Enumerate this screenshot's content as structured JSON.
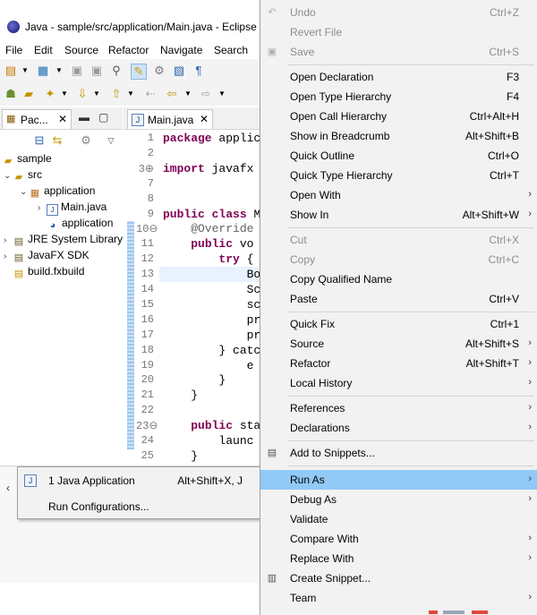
{
  "window": {
    "title": "Java - sample/src/application/Main.java - Eclipse"
  },
  "menubar": [
    "File",
    "Edit",
    "Source",
    "Refactor",
    "Navigate",
    "Search"
  ],
  "package_explorer": {
    "tab_label": "Pac...",
    "tree": [
      {
        "label": "sample",
        "icon": "project-icon"
      },
      {
        "label": "src",
        "icon": "source-folder-icon"
      },
      {
        "label": "application",
        "icon": "package-icon"
      },
      {
        "label": "Main.java",
        "icon": "java-file-icon"
      },
      {
        "label": "application",
        "icon": "css-file-icon"
      },
      {
        "label": "JRE System Library",
        "icon": "library-icon"
      },
      {
        "label": "JavaFX SDK",
        "icon": "library-icon"
      },
      {
        "label": "build.fxbuild",
        "icon": "file-icon"
      }
    ]
  },
  "editor": {
    "tab_label": "Main.java",
    "lines": [
      {
        "n": "1",
        "code": "package applic"
      },
      {
        "n": "2",
        "code": ""
      },
      {
        "n": "3⊕",
        "code": "import javafx"
      },
      {
        "n": "7",
        "code": ""
      },
      {
        "n": "8",
        "code": ""
      },
      {
        "n": "9",
        "code": "public class M"
      },
      {
        "n": "10⊖",
        "code": "    @Override"
      },
      {
        "n": "11",
        "code": "    public vo"
      },
      {
        "n": "12",
        "code": "        try {"
      },
      {
        "n": "13",
        "code": "            Bo"
      },
      {
        "n": "14",
        "code": "            Sc"
      },
      {
        "n": "15",
        "code": "            sc"
      },
      {
        "n": "16",
        "code": "            pr"
      },
      {
        "n": "17",
        "code": "            pr"
      },
      {
        "n": "18",
        "code": "        } catc"
      },
      {
        "n": "19",
        "code": "            e"
      },
      {
        "n": "20",
        "code": "        }"
      },
      {
        "n": "21",
        "code": "    }"
      },
      {
        "n": "22",
        "code": ""
      },
      {
        "n": "23⊖",
        "code": "    public sta"
      },
      {
        "n": "24",
        "code": "        launc"
      },
      {
        "n": "25",
        "code": "    }"
      }
    ]
  },
  "submenu": {
    "items": [
      {
        "label": "1 Java Application",
        "accel": "Alt+Shift+X, J",
        "icon": "java-app-icon"
      },
      {
        "label": "Run Configurations...",
        "accel": ""
      }
    ]
  },
  "context_menu": {
    "items": [
      {
        "label": "Undo",
        "accel": "Ctrl+Z",
        "disabled": true,
        "icon": "undo-icon"
      },
      {
        "label": "Revert File",
        "accel": "",
        "disabled": true
      },
      {
        "label": "Save",
        "accel": "Ctrl+S",
        "disabled": true,
        "icon": "save-icon"
      },
      {
        "sep": true
      },
      {
        "label": "Open Declaration",
        "accel": "F3"
      },
      {
        "label": "Open Type Hierarchy",
        "accel": "F4"
      },
      {
        "label": "Open Call Hierarchy",
        "accel": "Ctrl+Alt+H"
      },
      {
        "label": "Show in Breadcrumb",
        "accel": "Alt+Shift+B"
      },
      {
        "label": "Quick Outline",
        "accel": "Ctrl+O"
      },
      {
        "label": "Quick Type Hierarchy",
        "accel": "Ctrl+T"
      },
      {
        "label": "Open With",
        "accel": "",
        "submenu": true
      },
      {
        "label": "Show In",
        "accel": "Alt+Shift+W",
        "submenu": true
      },
      {
        "sep": true
      },
      {
        "label": "Cut",
        "accel": "Ctrl+X",
        "disabled": true
      },
      {
        "label": "Copy",
        "accel": "Ctrl+C",
        "disabled": true
      },
      {
        "label": "Copy Qualified Name",
        "accel": ""
      },
      {
        "label": "Paste",
        "accel": "Ctrl+V"
      },
      {
        "sep": true
      },
      {
        "label": "Quick Fix",
        "accel": "Ctrl+1"
      },
      {
        "label": "Source",
        "accel": "Alt+Shift+S",
        "submenu": true
      },
      {
        "label": "Refactor",
        "accel": "Alt+Shift+T",
        "submenu": true
      },
      {
        "label": "Local History",
        "accel": "",
        "submenu": true
      },
      {
        "sep": true
      },
      {
        "label": "References",
        "accel": "",
        "submenu": true
      },
      {
        "label": "Declarations",
        "accel": "",
        "submenu": true
      },
      {
        "sep": true
      },
      {
        "label": "Add to Snippets...",
        "accel": "",
        "icon": "snippet-icon"
      },
      {
        "sep": true
      },
      {
        "label": "Run As",
        "accel": "",
        "submenu": true,
        "selected": true
      },
      {
        "label": "Debug As",
        "accel": "",
        "submenu": true
      },
      {
        "label": "Validate",
        "accel": ""
      },
      {
        "label": "Compare With",
        "accel": "",
        "submenu": true
      },
      {
        "label": "Replace With",
        "accel": "",
        "submenu": true
      },
      {
        "label": "Create Snippet...",
        "accel": "",
        "icon": "create-snippet-icon"
      },
      {
        "label": "Team",
        "accel": "",
        "submenu": true
      }
    ]
  },
  "colors": {
    "selection": "#91c9f7",
    "menu_bg": "#f2f2f2",
    "disabled_text": "#8d8d8d",
    "keyword": "#7f0055"
  }
}
